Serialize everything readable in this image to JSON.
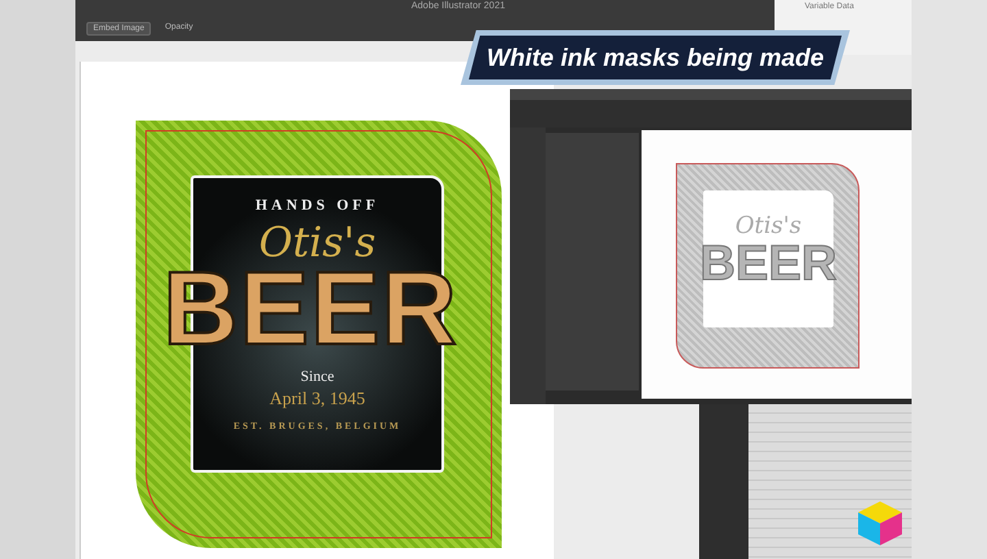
{
  "app_title": "Adobe Illustrator 2021",
  "toolbar": {
    "embed_button": "Embed Image",
    "opacity_label": "Opacity"
  },
  "side_panel_title": "Variable Data",
  "caption": "White ink masks being made",
  "label": {
    "top_line": "HANDS OFF",
    "name": "Otis's",
    "product": "BEER",
    "since": "Since",
    "date": "April 3, 1945",
    "origin": "EST. BRUGES, BELGIUM"
  },
  "mask_preview": {
    "name": "Otis's",
    "product": "BEER"
  }
}
